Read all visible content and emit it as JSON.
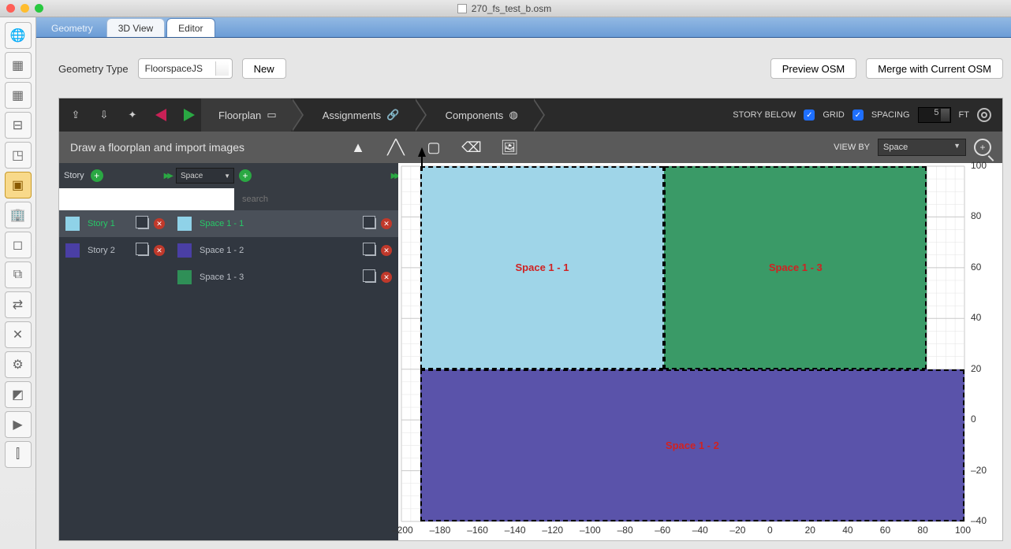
{
  "window": {
    "title": "270_fs_test_b.osm"
  },
  "tabs": {
    "geometry": "Geometry",
    "view3d": "3D View",
    "editor": "Editor",
    "active": "editor"
  },
  "toprow": {
    "label": "Geometry Type",
    "select_value": "FloorspaceJS",
    "new_btn": "New",
    "preview_btn": "Preview OSM",
    "merge_btn": "Merge with Current OSM"
  },
  "breadcrumb": {
    "floorplan": "Floorplan",
    "assignments": "Assignments",
    "components": "Components"
  },
  "header_right": {
    "story_below": "STORY BELOW",
    "grid": "GRID",
    "spacing_label": "SPACING",
    "spacing_value": "5",
    "spacing_unit": "FT"
  },
  "toolbar2": {
    "message": "Draw a floorplan and import images",
    "viewby_label": "VIEW BY",
    "viewby_value": "Space"
  },
  "row3": {
    "story_label": "Story",
    "type_select": "Space",
    "search_placeholder": "search"
  },
  "stories": [
    {
      "name": "Story 1",
      "color": "#8fd2e8",
      "selected": true
    },
    {
      "name": "Story 2",
      "color": "#4a3fa5",
      "selected": false
    }
  ],
  "spaces": [
    {
      "name": "Space 1 - 1",
      "color": "#8fd2e8",
      "selected": true
    },
    {
      "name": "Space 1 - 2",
      "color": "#4a3fa5",
      "selected": false
    },
    {
      "name": "Space 1 - 3",
      "color": "#2f8f57",
      "selected": false
    }
  ],
  "rail_icons": [
    "globe",
    "calendar",
    "blocks",
    "outlet",
    "cube",
    "floorplan",
    "building",
    "box",
    "boxes",
    "swap",
    "wrench",
    "gear2",
    "surface",
    "play",
    "chart"
  ],
  "rail_active_index": 5,
  "chart_data": {
    "type": "floorplan",
    "x_range": [
      -200,
      100
    ],
    "y_range": [
      -40,
      100
    ],
    "x_ticks": [
      -200,
      -180,
      -160,
      -140,
      -120,
      -100,
      -80,
      -60,
      -40,
      -20,
      0,
      20,
      40,
      60,
      80,
      100
    ],
    "y_ticks": [
      -40,
      -20,
      0,
      20,
      40,
      60,
      80,
      100
    ],
    "grid_spacing": 5,
    "zones": [
      {
        "name": "Space 1 - 1",
        "color": "#9fd5e8",
        "x0": -190,
        "x1": -60,
        "y0": 20,
        "y1": 100
      },
      {
        "name": "Space 1 - 3",
        "color": "#3a9a67",
        "x0": -60,
        "x1": 80,
        "y0": 20,
        "y1": 100
      },
      {
        "name": "Space 1 - 2",
        "color": "#5a53aa",
        "x0": -190,
        "x1": 100,
        "y0": -40,
        "y1": 20
      }
    ]
  }
}
